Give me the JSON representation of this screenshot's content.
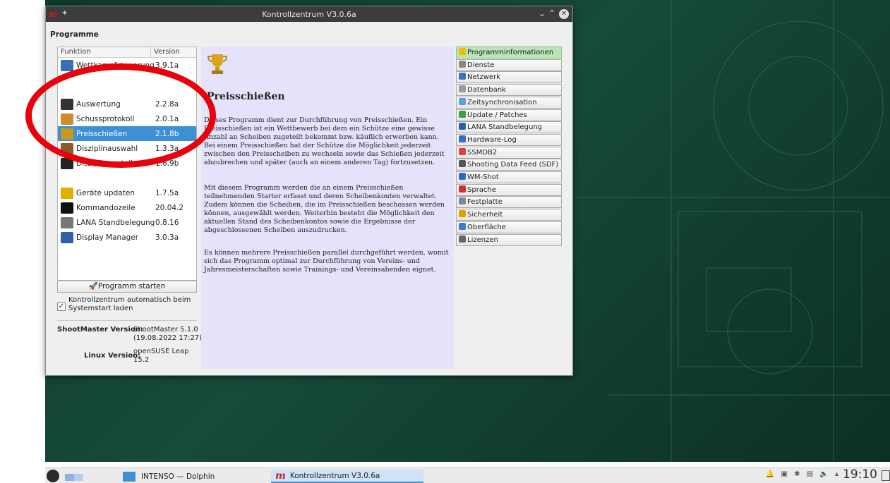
{
  "window": {
    "title": "Kontrollzentrum V3.0.6a",
    "section": "Programme"
  },
  "list": {
    "col_function": "Funktion",
    "col_version": "Version",
    "items": [
      {
        "name": "Wettkampfsteuerung",
        "version": "3.9.1a",
        "icon": "monitor-icon",
        "color": "#3b6fb5"
      },
      {
        "name": "Auswertung",
        "version": "2.2.8a",
        "icon": "tools-icon",
        "color": "#333333"
      },
      {
        "name": "Schussprotokoll",
        "version": "2.0.1a",
        "icon": "pen-icon",
        "color": "#d08c2a"
      },
      {
        "name": "Preisschießen",
        "version": "2.1.8b",
        "icon": "trophy-icon",
        "color": "#c79a1e"
      },
      {
        "name": "Disziplinauswahl",
        "version": "1.3.3a",
        "icon": "rifle-icon",
        "color": "#8a5a2a"
      },
      {
        "name": "Disziplin erstellen",
        "version": "1.6.9b",
        "icon": "target-icon",
        "color": "#222222"
      },
      {
        "name": "Geräte updaten",
        "version": "1.7.5a",
        "icon": "wand-icon",
        "color": "#e0b000"
      },
      {
        "name": "Kommandozeile",
        "version": "20.04.2",
        "icon": "terminal-icon",
        "color": "#111111"
      },
      {
        "name": "LANA Standbelegung",
        "version": "0.8.16",
        "icon": "document-icon",
        "color": "#777777"
      },
      {
        "name": "Display Manager",
        "version": "3.0.3a",
        "icon": "display-icon",
        "color": "#2f5fa8"
      }
    ]
  },
  "start_button": "Programm starten",
  "autostart_label": "Kontrollzentrum automatisch beim Systemstart laden",
  "autostart_checked": "✓",
  "versions": {
    "shootmaster_label": "ShootMaster Version:",
    "shootmaster_value": "ShootMaster 5.1.0",
    "shootmaster_date": "(19.08.2022 17:27)",
    "linux_label": "Linux Version:",
    "linux_value": "openSUSE Leap",
    "linux_value2": "15.2"
  },
  "panel": {
    "title": "Preisschießen",
    "p1": "Dieses Programm dient zur Durchführung von Preisschießen. Ein Preisschießen ist ein Wettbewerb bei dem ein Schütze eine gewisse Anzahl an Scheiben zugeteilt bekommt bzw. käuflich erwerben kann. Bei einem Preisschießen hat der Schütze die Möglichkeit jederzeit zwischen den Preisscheiben zu wechseln sowie das Schießen jederzeit abzubrechen und später (auch an einem anderen Tag) fortzusetzen.",
    "p2": "Mit diesem Programm werden die an einem Preisschießen teilnehmenden Starter erfasst und deren Scheibenkonten verwaltet. Zudem können die Scheiben, die im Preisschießen beschossen werden können, ausgewählt werden. Weiterhin besteht die Möglichkeit den aktuellen Stand des Scheibenkontos sowie die Ergebnisse der abgeschlossenen Scheiben auszudrucken.",
    "p3": "Es können mehrere Preisschießen parallel durchgeführt werden, womit sich das Programm optimal zur Durchführung von Vereins- und Jahresmeisterschaften sowie Trainings- und Vereinsabenden eignet."
  },
  "right_buttons": [
    {
      "label": "Programminformationen",
      "icon": "info-icon",
      "color": "#f0c000"
    },
    {
      "label": "Dienste",
      "icon": "services-icon",
      "color": "#888888"
    },
    {
      "label": "Netzwerk",
      "icon": "network-icon",
      "color": "#3a72c4"
    },
    {
      "label": "Datenbank",
      "icon": "database-icon",
      "color": "#9a9a9a"
    },
    {
      "label": "Zeitsynchronisation",
      "icon": "clock-icon",
      "color": "#5aa0e0"
    },
    {
      "label": "Update / Patches",
      "icon": "update-icon",
      "color": "#3aa04a"
    },
    {
      "label": "LANA Standbelegung",
      "icon": "lana-icon",
      "color": "#2f5fa8"
    },
    {
      "label": "Hardware-Log",
      "icon": "hardware-log-icon",
      "color": "#2f6fd0"
    },
    {
      "label": "SSMDB2",
      "icon": "ssmdb-icon",
      "color": "#e04040"
    },
    {
      "label": "Shooting Data Feed (SDF)",
      "icon": "sdf-icon",
      "color": "#555555"
    },
    {
      "label": "WM-Shot",
      "icon": "globe-icon",
      "color": "#2a6ad0"
    },
    {
      "label": "Sprache",
      "icon": "flag-icon",
      "color": "#d03030"
    },
    {
      "label": "Festplatte",
      "icon": "disk-icon",
      "color": "#7a8a9a"
    },
    {
      "label": "Sicherheit",
      "icon": "lock-icon",
      "color": "#e0a000"
    },
    {
      "label": "Oberfläche",
      "icon": "window-icon",
      "color": "#3a7ad0"
    },
    {
      "label": "Lizenzen",
      "icon": "license-icon",
      "color": "#666666"
    }
  ],
  "taskbar": {
    "task1": "INTENSO — Dolphin",
    "task2_logo": "m",
    "task2": "Kontrollzentrum V3.0.6a",
    "tray": "🔔 ▣ ✱ ▤ 🔈 ▴",
    "clock": "19:10"
  }
}
